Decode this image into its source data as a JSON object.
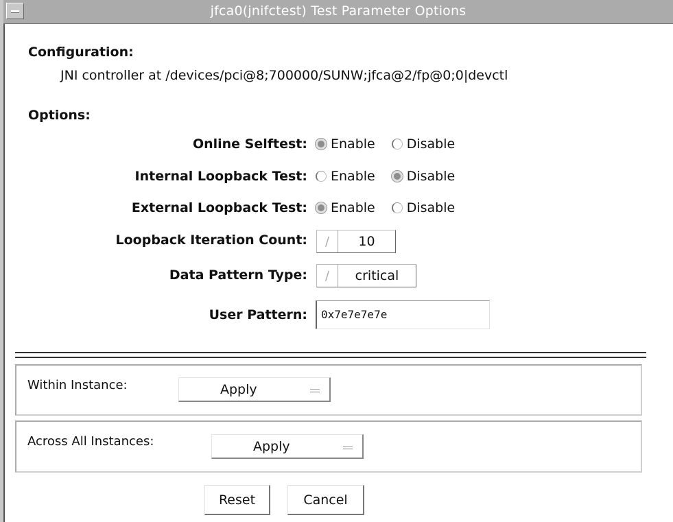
{
  "window": {
    "title": "jfca0(jnifctest) Test Parameter Options"
  },
  "configuration": {
    "heading": "Configuration:",
    "value": "JNI controller at /devices/pci@8;700000/SUNW;jfca@2/fp@0;0|devctl"
  },
  "options": {
    "heading": "Options:",
    "online_selftest": {
      "label": "Online Selftest:",
      "enable": "Enable",
      "disable": "Disable",
      "selected": "Enable"
    },
    "internal_loopback": {
      "label": "Internal Loopback Test:",
      "enable": "Enable",
      "disable": "Disable",
      "selected": "Disable"
    },
    "external_loopback": {
      "label": "External Loopback Test:",
      "enable": "Enable",
      "disable": "Disable",
      "selected": "Enable"
    },
    "iteration_count": {
      "label": "Loopback Iteration Count:",
      "value": "10"
    },
    "data_pattern": {
      "label": "Data Pattern Type:",
      "value": "critical"
    },
    "user_pattern": {
      "label": "User Pattern:",
      "value": "0x7e7e7e7e"
    }
  },
  "within_instance": {
    "label": "Within Instance:",
    "value": "Apply"
  },
  "across_instances": {
    "label": "Across All Instances:",
    "value": "Apply"
  },
  "buttons": {
    "reset": "Reset",
    "cancel": "Cancel"
  }
}
